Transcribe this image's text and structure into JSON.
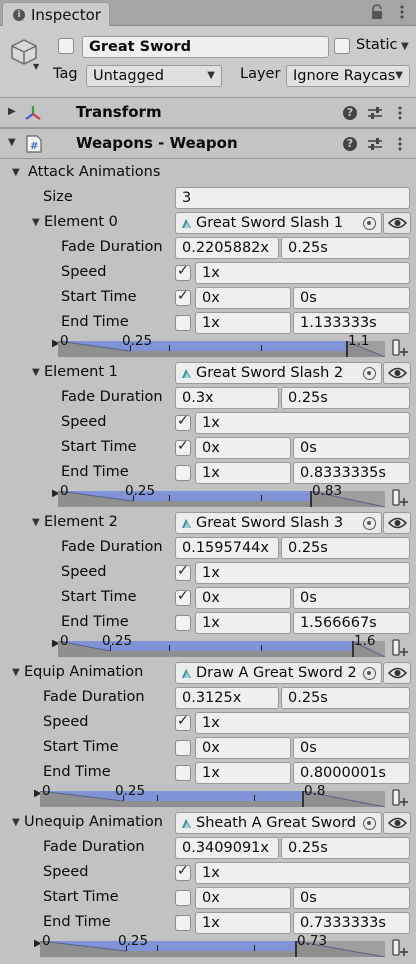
{
  "window": {
    "tab_label": "Inspector"
  },
  "header": {
    "object_name": "Great Sword",
    "static_label": "Static",
    "tag_label": "Tag",
    "tag_value": "Untagged",
    "layer_label": "Layer",
    "layer_value": "Ignore Raycas",
    "active_checked": false,
    "static_checked": false
  },
  "components": [
    {
      "title": "Transform",
      "expanded": false
    },
    {
      "title": "Weapons - Weapon",
      "expanded": true
    }
  ],
  "weapon": {
    "attack_animations_label": "Attack Animations",
    "size_label": "Size",
    "size_value": "3",
    "labels": {
      "fade": "Fade Duration",
      "speed": "Speed",
      "start": "Start Time",
      "end": "End Time"
    },
    "elements": [
      {
        "label": "Element 0",
        "clip": "Great Sword Slash 1",
        "fade_x": "0.2205882x",
        "fade_s": "0.25s",
        "speed_checked": true,
        "speed": "1x",
        "start_checked": true,
        "start_x": "0x",
        "start_s": "0s",
        "end_checked": false,
        "end_x": "1x",
        "end_s": "1.133333s",
        "timeline": {
          "start": "0",
          "mid": "0.25",
          "end": "1.1",
          "end_fraction": 0.88,
          "mid_fraction": 0.22
        }
      },
      {
        "label": "Element 1",
        "clip": "Great Sword Slash 2",
        "fade_x": "0.3x",
        "fade_s": "0.25s",
        "speed_checked": true,
        "speed": "1x",
        "start_checked": true,
        "start_x": "0x",
        "start_s": "0s",
        "end_checked": false,
        "end_x": "1x",
        "end_s": "0.8333335s",
        "timeline": {
          "start": "0",
          "mid": "0.25",
          "end": "0.83",
          "end_fraction": 0.77,
          "mid_fraction": 0.23
        }
      },
      {
        "label": "Element 2",
        "clip": "Great Sword Slash 3",
        "fade_x": "0.1595744x",
        "fade_s": "0.25s",
        "speed_checked": true,
        "speed": "1x",
        "start_checked": true,
        "start_x": "0x",
        "start_s": "0s",
        "end_checked": false,
        "end_x": "1x",
        "end_s": "1.566667s",
        "timeline": {
          "start": "0",
          "mid": "0.25",
          "end": "1.6",
          "end_fraction": 0.9,
          "mid_fraction": 0.16
        }
      }
    ],
    "equip": {
      "label": "Equip Animation",
      "clip": "Draw A Great Sword 2",
      "fade_x": "0.3125x",
      "fade_s": "0.25s",
      "speed_checked": true,
      "speed": "1x",
      "start_checked": false,
      "start_x": "0x",
      "start_s": "0s",
      "end_checked": false,
      "end_x": "1x",
      "end_s": "0.8000001s",
      "timeline": {
        "start": "0",
        "mid": "0.25",
        "end": "0.8",
        "end_fraction": 0.76,
        "mid_fraction": 0.24
      }
    },
    "unequip": {
      "label": "Unequip Animation",
      "clip": "Sheath A Great Sword",
      "fade_x": "0.3409091x",
      "fade_s": "0.25s",
      "speed_checked": true,
      "speed": "1x",
      "start_checked": false,
      "start_x": "0x",
      "start_s": "0s",
      "end_checked": false,
      "end_x": "1x",
      "end_s": "0.7333333s",
      "timeline": {
        "start": "0",
        "mid": "0.25",
        "end": "0.73",
        "end_fraction": 0.74,
        "mid_fraction": 0.25
      }
    }
  },
  "colors": {
    "timeline_blue": "#7f93d6",
    "timeline_gray": "#8f8f8f",
    "panel": "#c2c2c2"
  },
  "icons": [
    "info-icon",
    "lock-icon",
    "menu-icon",
    "gameobject-cube-icon",
    "transform-axes-icon",
    "script-icon",
    "help-icon",
    "presets-icon",
    "kebab-icon",
    "animation-clip-icon",
    "object-picker-icon",
    "eye-icon",
    "add-event-icon"
  ]
}
